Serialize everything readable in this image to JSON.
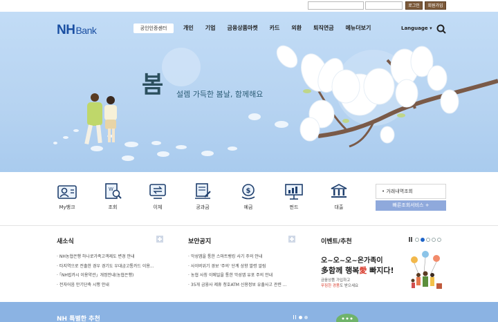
{
  "topbar": {
    "login_label": "로그인",
    "join_label": "회원가입"
  },
  "header": {
    "logo_main": "NH",
    "logo_sub": "Bank",
    "cert_center": "공인인증센터",
    "nav": [
      "개인",
      "기업",
      "금융상품마켓",
      "카드",
      "외환",
      "퇴직연금",
      "메뉴더보기"
    ],
    "language": "Language ▾",
    "search_icon": "search-icon"
  },
  "hero": {
    "calligraphy": "봄",
    "slogan": "설렘 가득한 봄날, 함께해요"
  },
  "quick_menu": {
    "items": [
      {
        "label": "My뱅크",
        "icon": "user-card-icon"
      },
      {
        "label": "조회",
        "icon": "document-search-icon"
      },
      {
        "label": "이체",
        "icon": "transfer-icon"
      },
      {
        "label": "공과금",
        "icon": "bill-icon"
      },
      {
        "label": "예금",
        "icon": "deposit-icon"
      },
      {
        "label": "펀드",
        "icon": "chart-board-icon"
      },
      {
        "label": "대출",
        "icon": "bank-building-icon"
      }
    ],
    "account_lookup": "• 거래내역조회",
    "fast_service": "빠른조회서비스 +"
  },
  "news": {
    "title": "새소식",
    "items": [
      "NH농협은행 하나로가족고객제도 변경 안내",
      "타지역으로 전출한 경우 경기도 우대금고통카드 이용...",
      "「NH법카시 이용약관」개정안내(농협은행)",
      "전자어음 만기단축 시행 안내"
    ]
  },
  "security": {
    "title": "보안공지",
    "items": [
      "악성앱을 통한 스마트뱅킹 사기 주의 안내",
      "사이버위기 경보 '주의' 단계 상향 발령 알림",
      "농협 사칭 이메일을 통한 악성앱 유포 주의 안내",
      "35개 금융사 제휴 청호ATM 신용정보 유출사고 관련 ..."
    ]
  },
  "event": {
    "title": "이벤트/추천",
    "headline1": "오~오~오~온가족이",
    "headline2_a": "多함께 행복",
    "headline2_red": "愛",
    "headline2_b": " 빠지다!",
    "sub1": "금융상품 가입하고",
    "sub2_red": "푸짐한 경품",
    "sub2_b": "도 받으세요"
  },
  "bottom": {
    "title": "NH 특별한 추천"
  },
  "colors": {
    "brand_blue": "#1a4fa2",
    "hero_sky": "#b7d6f4",
    "button_brown": "#7c5a3a",
    "fast_service": "#8fa9dc",
    "event_red": "#d83a2b"
  }
}
